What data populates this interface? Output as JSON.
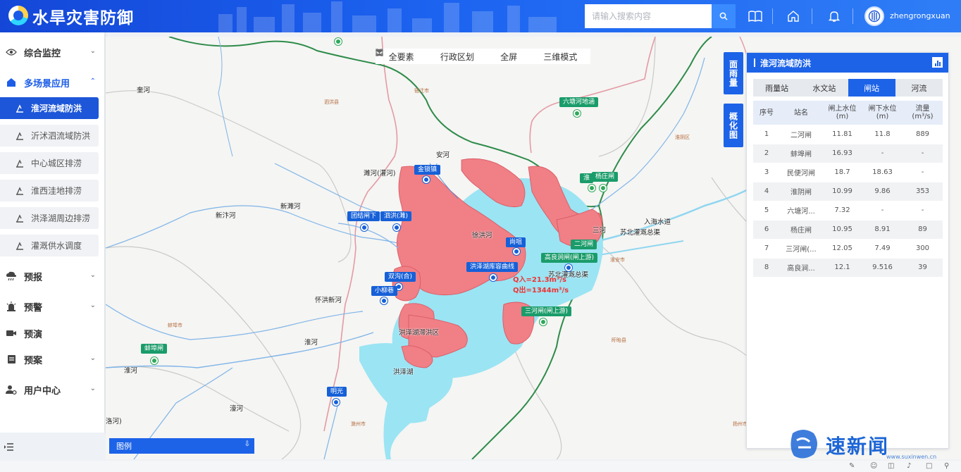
{
  "header": {
    "app_title": "水旱灾害防御",
    "search_placeholder": "请输入搜索内容",
    "username": "zhengrongxuan"
  },
  "sidebar": {
    "menus": [
      {
        "label": "综合监控",
        "icon": "eye-icon",
        "expanded": false
      },
      {
        "label": "多场景应用",
        "icon": "home-icon",
        "expanded": true
      },
      {
        "label": "预报",
        "icon": "cloud-rain-icon",
        "expanded": false
      },
      {
        "label": "预警",
        "icon": "alarm-icon",
        "expanded": false
      },
      {
        "label": "预演",
        "icon": "video-camera-icon",
        "expanded": false
      },
      {
        "label": "预案",
        "icon": "document-icon",
        "expanded": false
      },
      {
        "label": "用户中心",
        "icon": "user-gear-icon",
        "expanded": false
      }
    ],
    "sub_items": [
      {
        "label": "淮河流域防洪",
        "active": true
      },
      {
        "label": "沂沭泗流域防洪",
        "active": false
      },
      {
        "label": "中心城区排涝",
        "active": false
      },
      {
        "label": "淮西洼地排涝",
        "active": false
      },
      {
        "label": "洪泽湖周边排涝",
        "active": false
      },
      {
        "label": "灌溉供水调度",
        "active": false
      }
    ]
  },
  "map": {
    "toolbar": [
      {
        "label": "全要素",
        "icon": "layers-icon"
      },
      {
        "label": "行政区划",
        "icon": "region-icon"
      },
      {
        "label": "全屏",
        "icon": "fullscreen-icon"
      },
      {
        "label": "三维模式",
        "icon": "cube-3d-icon"
      }
    ],
    "side_buttons": [
      "面雨量",
      "概化图"
    ],
    "legend_label": "图例",
    "place_labels": {
      "p1": "奎河",
      "p2": "安河",
      "p3": "濉河(灌河)",
      "p4": "新濉河",
      "p5": "新汴河",
      "p6": "徐洪河",
      "p7": "三河",
      "p8": "入海水道",
      "p9": "苏北灌溉总渠",
      "p10": "苏北灌溉总渠",
      "p11": "怀洪新河",
      "p12": "洪泽湖滞洪区",
      "p13": "淮河",
      "p14": "洪泽湖",
      "p15": "淮河",
      "p16": "濠河",
      "p17": "洛河)"
    },
    "small_labels": {
      "s1": "宿迁市",
      "s2": "淮安市",
      "s3": "蚌埠市",
      "s4": "滁州市",
      "s5": "扬州市",
      "s6": "泗洪县",
      "s7": "盱眙县",
      "s8": "淮阴区"
    },
    "stations": {
      "st1": "六塘河地涵",
      "st2": "金锁镇",
      "st3": "团结闸下",
      "st4": "泗洪(濉)",
      "st5": "尚咀",
      "st6": "二河闸",
      "st7": "高良涧闸(闸上游)",
      "st8": "洪泽湖库容曲线",
      "st9": "双沟(合)",
      "st10": "小柳巷",
      "st11": "三河闸(闸上游)",
      "st12": "蚌埠闸",
      "st13": "明光",
      "st14": "杨庄闸",
      "st15": "淮"
    },
    "flow_in": "Q入=21.3m³/s",
    "flow_out": "Q出=1344m³/s"
  },
  "panel": {
    "title": "淮河流域防洪",
    "tabs": [
      {
        "label": "雨量站",
        "active": false
      },
      {
        "label": "水文站",
        "active": false
      },
      {
        "label": "闸站",
        "active": true
      },
      {
        "label": "河流",
        "active": false
      }
    ],
    "columns": [
      "序号",
      "站名",
      "闸上水位\n(m)",
      "闸下水位\n(m)",
      "流量\n(m³/s)"
    ],
    "rows": [
      [
        "1",
        "二河闸",
        "11.81",
        "11.8",
        "889"
      ],
      [
        "2",
        "蚌埠闸",
        "16.93",
        "-",
        "-"
      ],
      [
        "3",
        "民便河闸",
        "18.7",
        "18.63",
        "-"
      ],
      [
        "4",
        "淮阴闸",
        "10.99",
        "9.86",
        "353"
      ],
      [
        "5",
        "六塘河...",
        "7.32",
        "-",
        "-"
      ],
      [
        "6",
        "杨庄闸",
        "10.95",
        "8.91",
        "89"
      ],
      [
        "7",
        "三河闸(...",
        "12.05",
        "7.49",
        "300"
      ],
      [
        "8",
        "高良涧...",
        "12.1",
        "9.516",
        "39"
      ]
    ]
  },
  "watermark": {
    "text": "速新闻",
    "url": "www.suxinwen.cn"
  }
}
